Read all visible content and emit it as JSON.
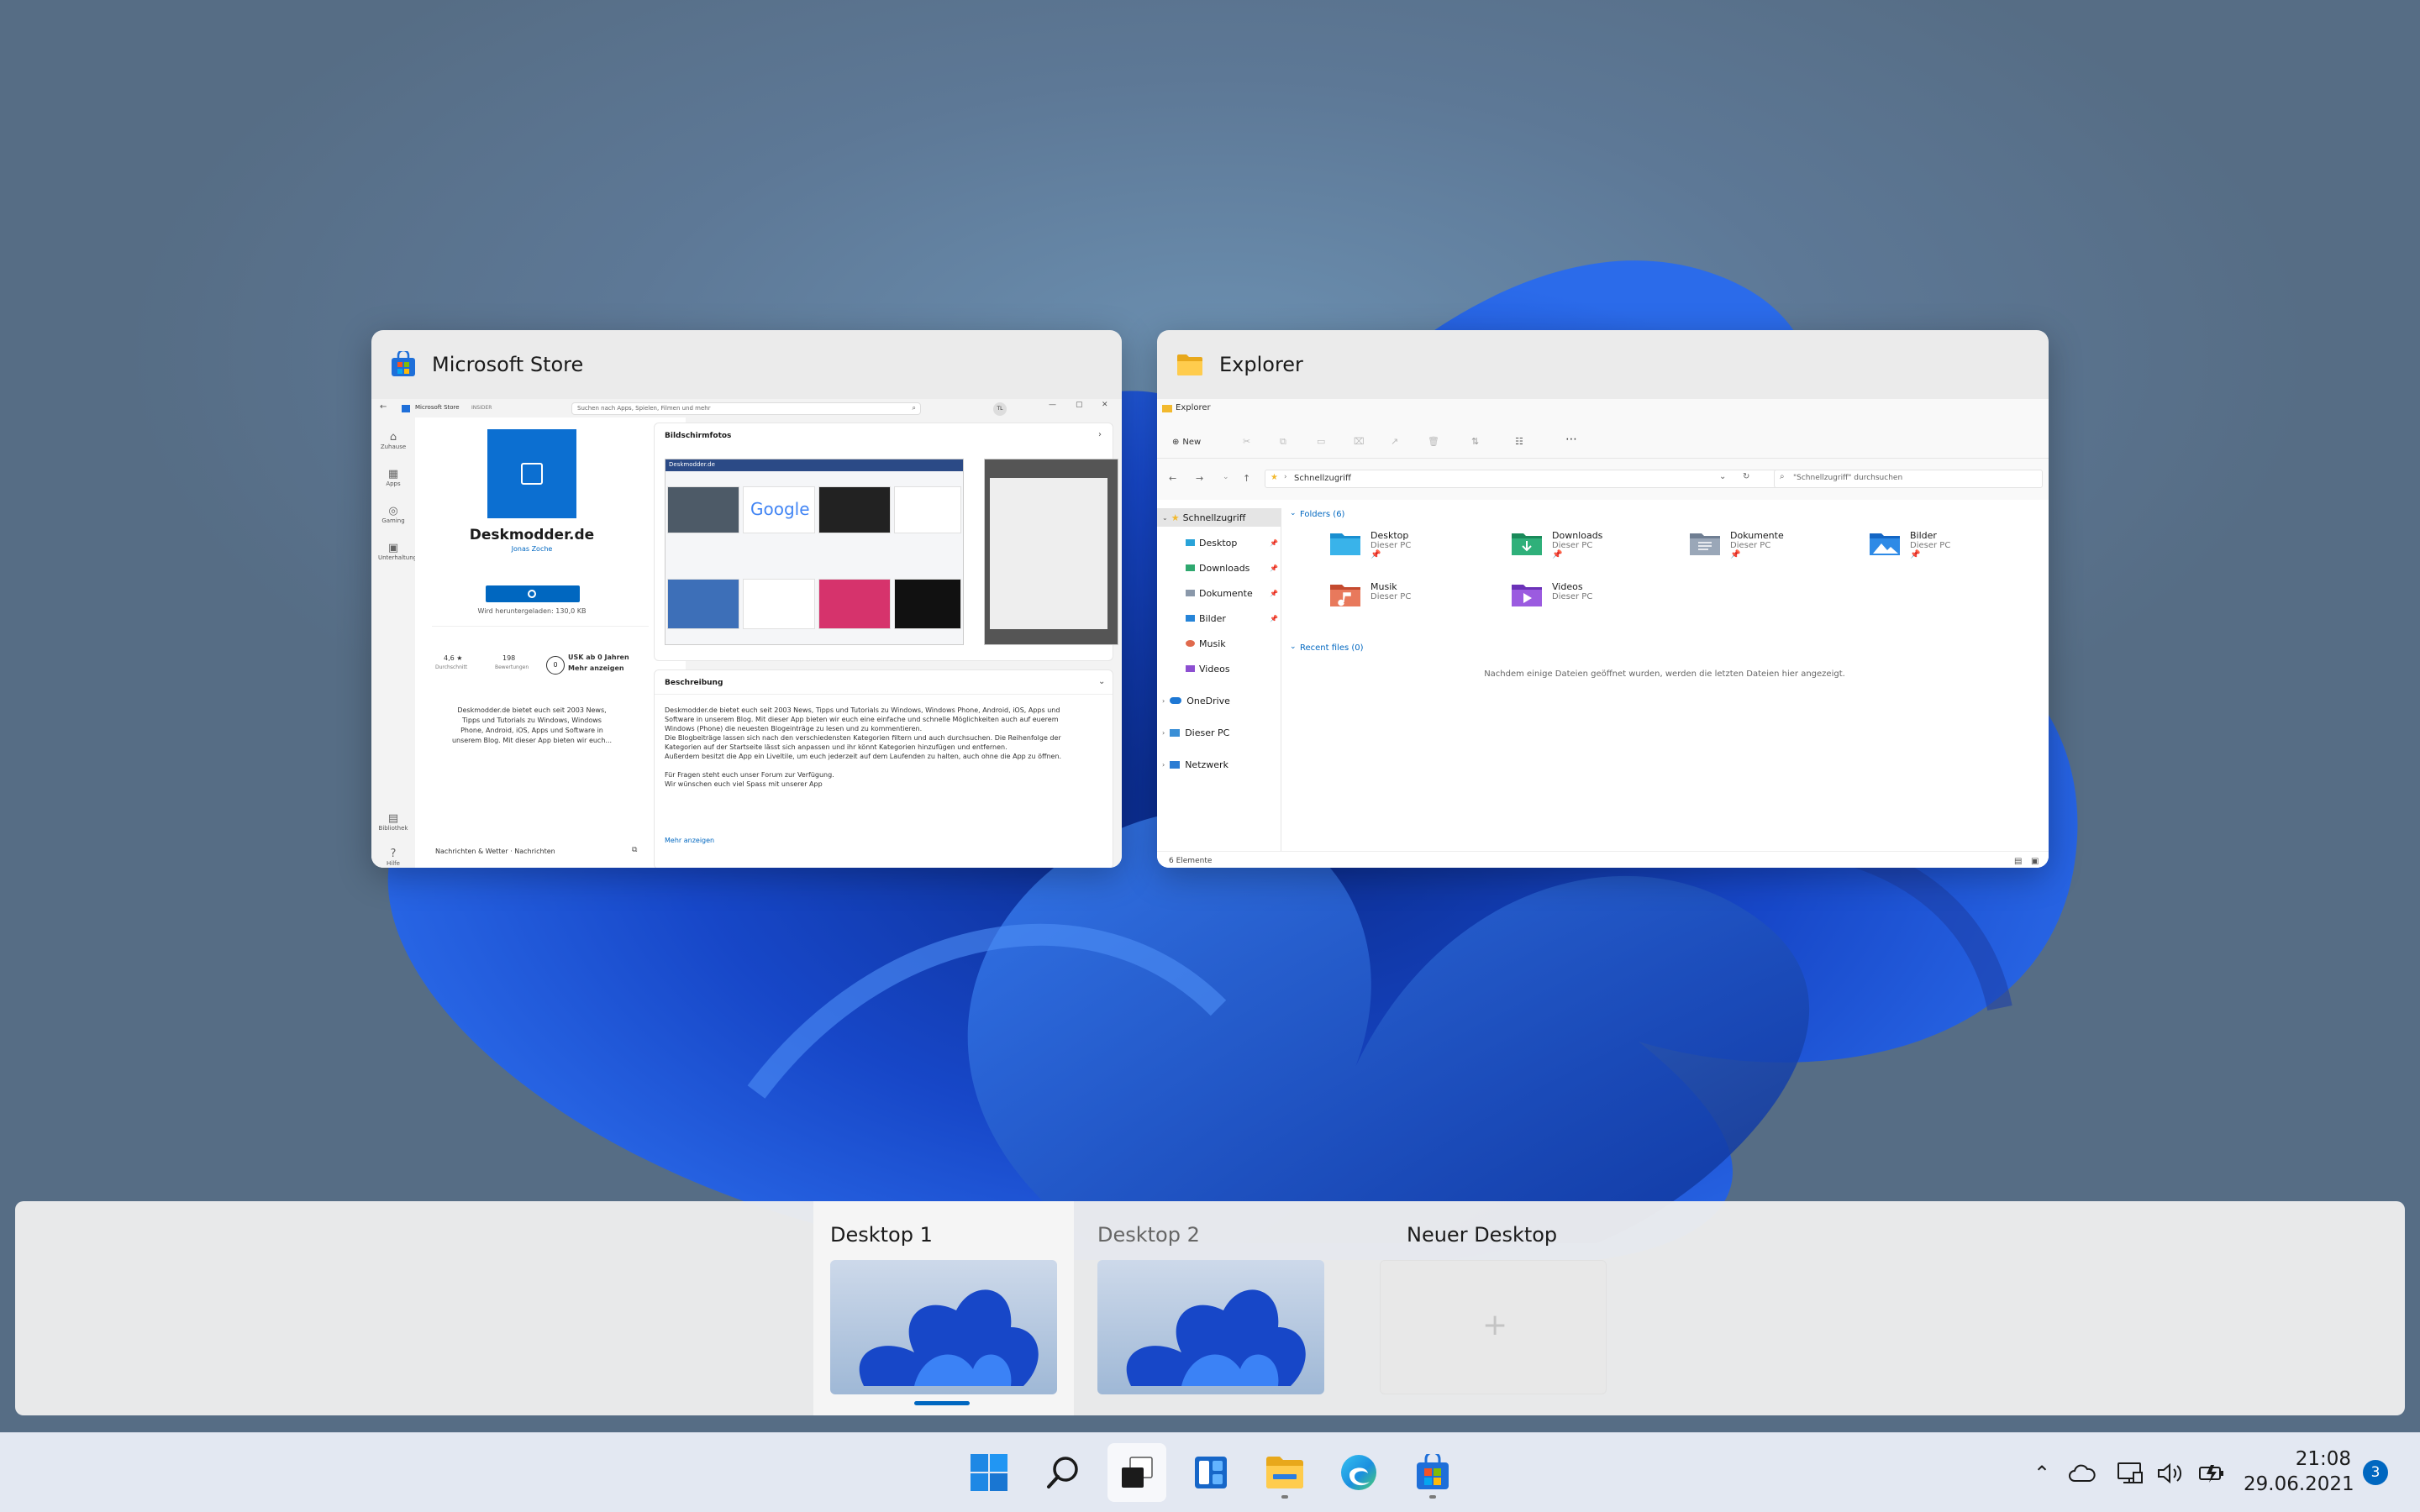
{
  "taskview": {
    "windows": [
      {
        "title": "Microsoft Store",
        "icon": "microsoft-store-icon"
      },
      {
        "title": "Explorer",
        "icon": "folder-icon"
      }
    ]
  },
  "store": {
    "header": "Microsoft Store",
    "header_badge": "INSIDER",
    "search_placeholder": "Suchen nach Apps, Spielen, Filmen und mehr",
    "user_initials": "TL",
    "nav": [
      "Zuhause",
      "Apps",
      "Gaming",
      "Unterhaltung",
      "Bibliothek",
      "Hilfe"
    ],
    "app_name": "Deskmodder.de",
    "publisher": "Jonas Zoche",
    "download_status": "Wird heruntergeladen: 130,0 KB",
    "rating": "4,6 ★",
    "rating_label": "Durchschnitt",
    "reviews": "198",
    "reviews_label": "Bewertungen",
    "usk": "USK ab 0 Jahren",
    "more": "Mehr anzeigen",
    "short_desc": [
      "Deskmodder.de bietet euch seit 2003 News,",
      "Tipps und Tutorials zu Windows, Windows",
      "Phone, Android, iOS, Apps und Software in",
      "unserem Blog. Mit dieser App bieten wir euch..."
    ],
    "category": "Nachrichten & Wetter · Nachrichten",
    "screenshots_title": "Bildschirmfotos",
    "screenshot_site_label": "Deskmodder.de",
    "screenshot_google": "Google",
    "desc_title": "Beschreibung",
    "desc": [
      "Deskmodder.de bietet euch seit 2003 News, Tipps und Tutorials zu Windows, Windows Phone, Android, iOS, Apps und",
      "Software in unserem Blog. Mit dieser App bieten wir euch eine einfache und schnelle Möglichkeiten auch auf euerem",
      "Windows (Phone) die neuesten Blogeinträge zu lesen und zu kommentieren.",
      "Die Blogbeiträge lassen sich nach den verschiedensten Kategorien filtern und auch durchsuchen. Die Reihenfolge der",
      "Kategorien auf der Startseite lässt sich anpassen und ihr könnt Kategorien hinzufügen und entfernen.",
      "Außerdem besitzt die App ein Liveltile, um euch jederzeit auf dem Laufenden zu halten, auch ohne die App zu öffnen.",
      "",
      "Für Fragen steht euch unser Forum zur Verfügung.",
      "Wir wünschen euch viel Spass mit unserer App"
    ],
    "desc_more": "Mehr anzeigen"
  },
  "explorer": {
    "title": "Explorer",
    "new_label": "New",
    "path": "Schnellzugriff",
    "search_placeholder": "\"Schnellzugriff\" durchsuchen",
    "sidebar": [
      "Schnellzugriff",
      "Desktop",
      "Downloads",
      "Dokumente",
      "Bilder",
      "Musik",
      "Videos",
      "OneDrive",
      "Dieser PC",
      "Netzwerk"
    ],
    "folders_header": "Folders (6)",
    "folders": [
      {
        "name": "Desktop",
        "sub": "Dieser PC"
      },
      {
        "name": "Downloads",
        "sub": "Dieser PC"
      },
      {
        "name": "Dokumente",
        "sub": "Dieser PC"
      },
      {
        "name": "Bilder",
        "sub": "Dieser PC"
      },
      {
        "name": "Musik",
        "sub": "Dieser PC"
      },
      {
        "name": "Videos",
        "sub": "Dieser PC"
      }
    ],
    "recent_header": "Recent files (0)",
    "recent_empty": "Nachdem einige Dateien geöffnet wurden, werden die letzten Dateien hier angezeigt.",
    "status": "6 Elemente"
  },
  "desktops": [
    {
      "label": "Desktop 1",
      "active": true
    },
    {
      "label": "Desktop 2",
      "active": false
    },
    {
      "label": "Neuer Desktop",
      "is_new": true
    }
  ],
  "taskbar": {
    "apps": [
      "start-icon",
      "search-icon",
      "task-view-icon",
      "widgets-icon",
      "file-explorer-icon",
      "edge-icon",
      "microsoft-store-icon"
    ],
    "time": "21:08",
    "date": "29.06.2021",
    "notifications": "3"
  },
  "colors": {
    "accent": "#0067c0",
    "taskbar": "#e3e8f2"
  }
}
